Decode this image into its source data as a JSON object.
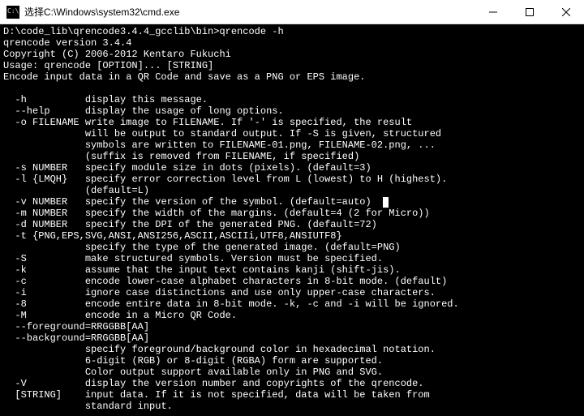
{
  "titlebar": {
    "title": "选择C:\\Windows\\system32\\cmd.exe"
  },
  "console": {
    "prompt": "D:\\code_lib\\qrencode3.4.4_gcclib\\bin>qrencode -h",
    "version_line": "qrencode version 3.4.4",
    "copyright_line": "Copyright (C) 2006-2012 Kentaro Fukuchi",
    "usage_line": "Usage: qrencode [OPTION]... [STRING]",
    "summary_line": "Encode input data in a QR Code and save as a PNG or EPS image.",
    "options": [
      {
        "flag": "  -h          ",
        "desc": "display this message."
      },
      {
        "flag": "  --help      ",
        "desc": "display the usage of long options."
      },
      {
        "flag": "  -o FILENAME ",
        "desc": "write image to FILENAME. If '-' is specified, the result"
      },
      {
        "flag": "              ",
        "desc": "will be output to standard output. If -S is given, structured"
      },
      {
        "flag": "              ",
        "desc": "symbols are written to FILENAME-01.png, FILENAME-02.png, ..."
      },
      {
        "flag": "              ",
        "desc": "(suffix is removed from FILENAME, if specified)"
      },
      {
        "flag": "  -s NUMBER   ",
        "desc": "specify module size in dots (pixels). (default=3)"
      },
      {
        "flag": "  -l {LMQH}   ",
        "desc": "specify error correction level from L (lowest) to H (highest)."
      },
      {
        "flag": "              ",
        "desc": "(default=L)"
      },
      {
        "flag": "  -v NUMBER   ",
        "desc": "specify the version of the symbol. (default=auto)",
        "cursor": true
      },
      {
        "flag": "  -m NUMBER   ",
        "desc": "specify the width of the margins. (default=4 (2 for Micro))"
      },
      {
        "flag": "  -d NUMBER   ",
        "desc": "specify the DPI of the generated PNG. (default=72)"
      },
      {
        "flag": "  -t {PNG,EPS,SVG,ANSI,ANSI256,ASCII,ASCIIi,UTF8,ANSIUTF8}",
        "desc": ""
      },
      {
        "flag": "              ",
        "desc": "specify the type of the generated image. (default=PNG)"
      },
      {
        "flag": "  -S          ",
        "desc": "make structured symbols. Version must be specified."
      },
      {
        "flag": "  -k          ",
        "desc": "assume that the input text contains kanji (shift-jis)."
      },
      {
        "flag": "  -c          ",
        "desc": "encode lower-case alphabet characters in 8-bit mode. (default)"
      },
      {
        "flag": "  -i          ",
        "desc": "ignore case distinctions and use only upper-case characters."
      },
      {
        "flag": "  -8          ",
        "desc": "encode entire data in 8-bit mode. -k, -c and -i will be ignored."
      },
      {
        "flag": "  -M          ",
        "desc": "encode in a Micro QR Code."
      },
      {
        "flag": "  --foreground=RRGGBB[AA]",
        "desc": ""
      },
      {
        "flag": "  --background=RRGGBB[AA]",
        "desc": ""
      },
      {
        "flag": "              ",
        "desc": "specify foreground/background color in hexadecimal notation."
      },
      {
        "flag": "              ",
        "desc": "6-digit (RGB) or 8-digit (RGBA) form are supported."
      },
      {
        "flag": "              ",
        "desc": "Color output support available only in PNG and SVG."
      },
      {
        "flag": "  -V          ",
        "desc": "display the version number and copyrights of the qrencode."
      },
      {
        "flag": "  [STRING]    ",
        "desc": "input data. If it is not specified, data will be taken from"
      },
      {
        "flag": "              ",
        "desc": "standard input."
      }
    ]
  }
}
